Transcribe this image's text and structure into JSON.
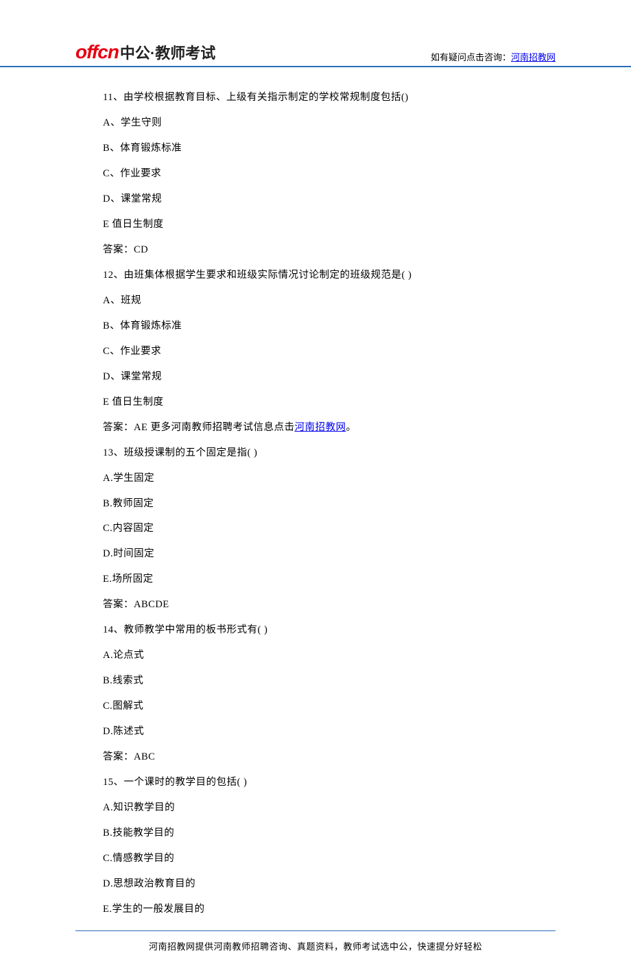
{
  "header": {
    "logo_en": "offcn",
    "logo_cn": "中公·教师考试",
    "consult_prefix": "如有疑问点击咨询：",
    "consult_link": "河南招教网"
  },
  "content": {
    "lines": [
      "11、由学校根据教育目标、上级有关指示制定的学校常规制度包括()",
      "A、学生守则",
      "B、体育锻炼标准",
      "C、作业要求",
      "D、课堂常规",
      "E 值日生制度",
      "答案：CD",
      "12、由班集体根据学生要求和班级实际情况讨论制定的班级规范是( )",
      "A、班规",
      "B、体育锻炼标准",
      "C、作业要求",
      "D、课堂常规",
      "E 值日生制度"
    ],
    "answer12_prefix": "答案：AE 更多河南教师招聘考试信息点击",
    "answer12_link": "河南招教网",
    "answer12_suffix": "。",
    "lines2": [
      "13、班级授课制的五个固定是指( )",
      "A.学生固定",
      "B.教师固定",
      "C.内容固定",
      "D.时间固定",
      "E.场所固定",
      "答案：ABCDE",
      "14、教师教学中常用的板书形式有( )",
      "A.论点式",
      "B.线索式",
      "C.图解式",
      "D.陈述式",
      "答案：ABC",
      "15、一个课时的教学目的包括( )",
      "A.知识教学目的",
      "B.技能教学目的",
      "C.情感教学目的",
      "D.思想政治教育目的",
      "E.学生的一般发展目的"
    ]
  },
  "footer": "河南招教网提供河南教师招聘咨询、真题资料，教师考试选中公，快速提分好轻松"
}
